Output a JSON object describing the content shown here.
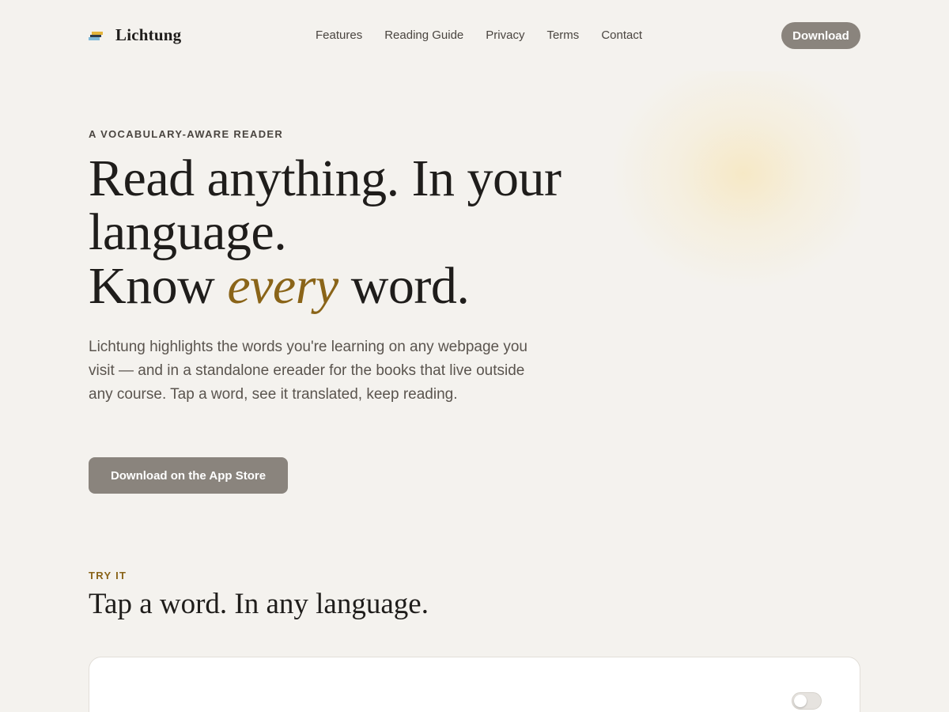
{
  "header": {
    "brand": "Lichtung",
    "nav": [
      "Features",
      "Reading Guide",
      "Privacy",
      "Terms",
      "Contact"
    ],
    "download_label": "Download"
  },
  "hero": {
    "eyebrow": "A VOCABULARY-AWARE READER",
    "title_line1": "Read anything. In your language.",
    "title_line2_pre": "Know ",
    "title_line2_accent": "every",
    "title_line2_post": " word.",
    "body": "Lichtung highlights the words you're learning on any webpage you visit — and in a standalone ereader for the books that live outside any course. Tap a word, see it translated, keep reading.",
    "cta_label": "Download on the App Store"
  },
  "try_it": {
    "eyebrow": "TRY IT",
    "title": "Tap a word. In any language."
  },
  "colors": {
    "background": "#f4f2ee",
    "accent": "#8a6418",
    "button": "#8a847d",
    "text": "#1f1d1b"
  },
  "icons": {
    "logo": "stacked-books-icon"
  }
}
